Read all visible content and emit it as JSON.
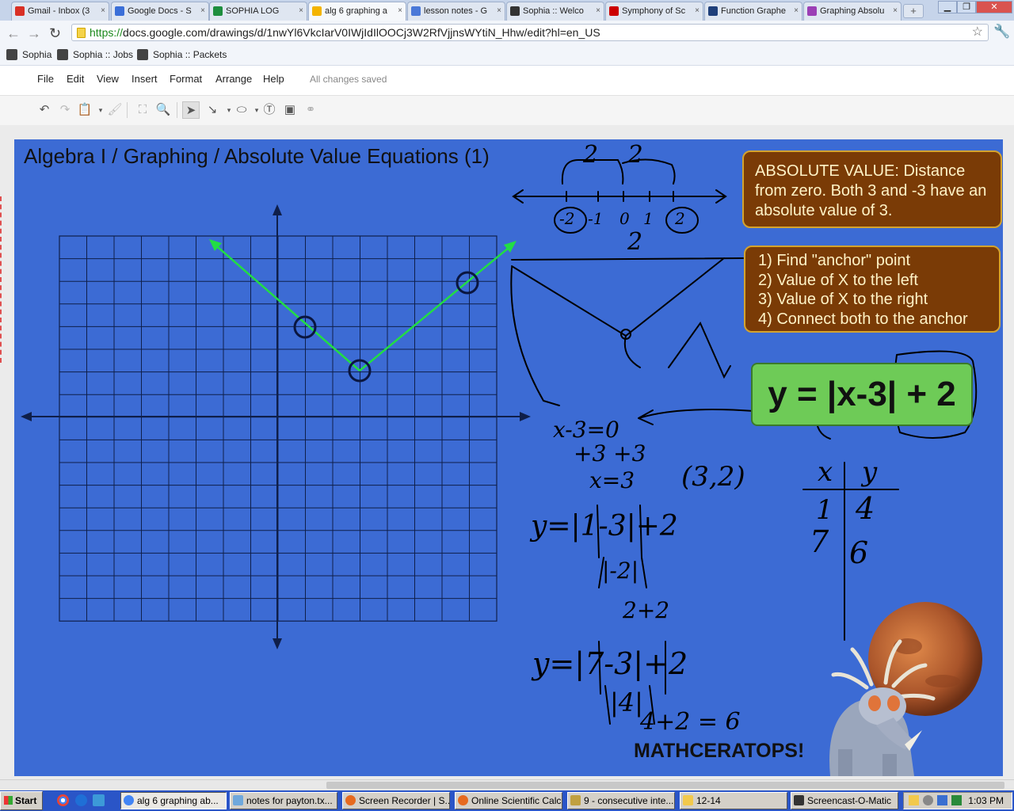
{
  "browser": {
    "tabs": [
      {
        "label": "Gmail - Inbox (3",
        "color": "#d93025"
      },
      {
        "label": "Google Docs - S",
        "color": "#3b6fd8"
      },
      {
        "label": "SOPHIA LOG",
        "color": "#1e8e3e"
      },
      {
        "label": "alg 6 graphing a",
        "color": "#f4b400",
        "active": true
      },
      {
        "label": "lesson notes - G",
        "color": "#4a78d8"
      },
      {
        "label": "Sophia :: Welco",
        "color": "#333333"
      },
      {
        "label": "Symphony of Sc",
        "color": "#cc0000"
      },
      {
        "label": "Function Graphe",
        "color": "#1f3f7a"
      },
      {
        "label": "Graphing Absolu",
        "color": "#9b3fb5"
      }
    ],
    "close_glyph": "×",
    "new_tab_glyph": "+",
    "url_scheme": "https://",
    "url_rest": "docs.google.com/drawings/d/1nwYl6VkcIarV0IWjIdIlOOCj3W2RfVjjnsWYtiN_Hhw/edit?hl=en_US",
    "bookmarks": [
      "Sophia",
      "Sophia :: Jobs",
      "Sophia :: Packets"
    ]
  },
  "app": {
    "menu": [
      "File",
      "Edit",
      "View",
      "Insert",
      "Format",
      "Arrange",
      "Help"
    ],
    "save_status": "All changes saved"
  },
  "slide": {
    "title": "Algebra I / Graphing / Absolute Value Equations (1)",
    "definition": "ABSOLUTE VALUE: Distance from zero. Both 3 and -3 have an absolute value of 3.",
    "steps": [
      "1) Find \"anchor\" point",
      "2) Value of X to the left",
      "3) Value of X to the right",
      "4) Connect both to the anchor"
    ],
    "equation": "y = |x-3| + 2",
    "mascot": "MATHCERATOPS!",
    "handwriting": {
      "number_line_top": "2 2",
      "number_line_ticks": [
        "-2",
        "-1",
        "0",
        "1",
        "2"
      ],
      "number_line_bottom": "2",
      "work": [
        "x-3=0",
        "+3 +3",
        "x=3",
        "(3,2)",
        "y=|1-3|+2",
        "|-2|",
        "2+2",
        "y=|7-3|+2",
        "|4|",
        "4+2 = 6"
      ],
      "table_headers": [
        "x",
        "y"
      ],
      "table_rows": [
        [
          "1",
          "4"
        ],
        [
          "7",
          "6"
        ]
      ]
    },
    "colors": {
      "background": "#3c6bd4",
      "info_box": "#7a3b06",
      "equation_box": "#6ecb57",
      "graph_line": "#22dd44"
    }
  },
  "taskbar": {
    "start": "Start",
    "tasks": [
      "alg 6 graphing ab...",
      "notes for payton.tx...",
      "Screen Recorder | S...",
      "Online Scientific Calc...",
      "9 - consecutive inte...",
      "12-14",
      "Screencast-O-Matic"
    ],
    "clock": "1:03 PM"
  }
}
